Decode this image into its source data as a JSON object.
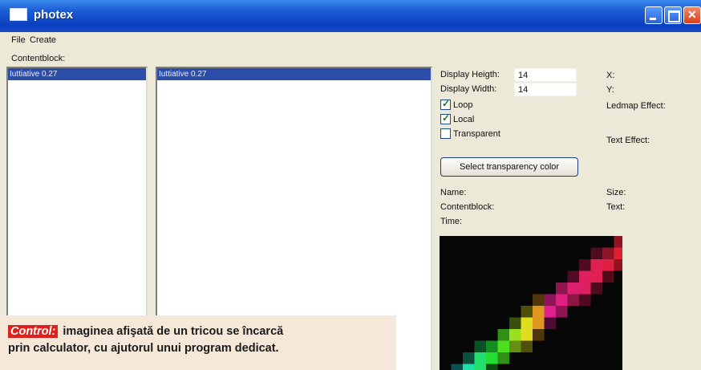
{
  "window": {
    "title": "photex",
    "controls": [
      "minimize",
      "maximize",
      "close"
    ]
  },
  "menu": {
    "file": "File",
    "create": "Create"
  },
  "contentblock_label": "Contentblock:",
  "lists": {
    "left_selected": "Iuttiative 0.27",
    "middle_selected": "Iuttiative 0.27"
  },
  "properties": {
    "display_height_label": "Display Heigth:",
    "display_height_value": "14",
    "display_width_label": "Display Width:",
    "display_width_value": "14",
    "x_label": "X:",
    "y_label": "Y:",
    "ledmap_effect_label": "Ledmap Effect:",
    "text_effect_label": "Text Effect:",
    "loop": {
      "label": "Loop",
      "checked": true
    },
    "local": {
      "label": "Local",
      "checked": true
    },
    "transparent": {
      "label": "Transparent",
      "checked": false
    },
    "select_color_button": "Select transparency color",
    "name_label": "Name:",
    "size_label": "Size:",
    "contentblock_label": "Contentblock:",
    "text_label": "Text:",
    "time_label": "Time:"
  },
  "caption": {
    "tag": "Control:",
    "line1": "imaginea afişată de un tricou se încarcă",
    "line2": "prin calculator, cu ajutorul unui program dedicat."
  },
  "colors": {
    "titlebar": "#0a3fbf",
    "selection": "#2d4ea8",
    "caption_tag": "#e0201a",
    "preview_bg": "#070707"
  },
  "icons": [
    "app-window-icon",
    "minimize-icon",
    "maximize-icon",
    "close-icon",
    "checkmark-icon"
  ]
}
